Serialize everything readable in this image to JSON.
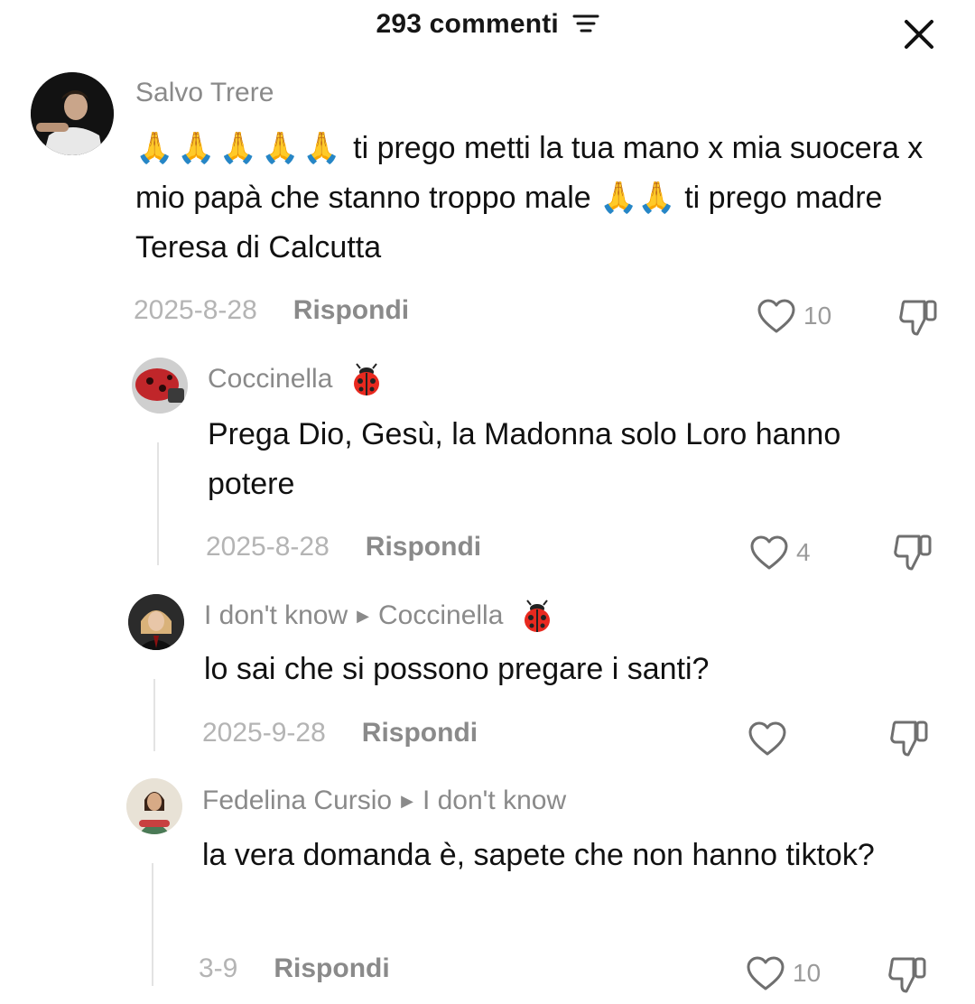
{
  "header": {
    "title": "293 commenti"
  },
  "comments": [
    {
      "username": "Salvo Trere",
      "text_prefix": "🙏🙏🙏🙏🙏",
      "text": " ti prego metti la tua mano x mia suocera x mio papà che stanno troppo male 🙏🙏 ti prego madre Teresa di Calcutta",
      "date": "2025-8-28",
      "reply_label": "Rispondi",
      "likes": "10"
    },
    {
      "username": "Coccinella",
      "text": "Prega Dio, Gesù, la Madonna solo Loro hanno potere",
      "date": "2025-8-28",
      "reply_label": "Rispondi",
      "likes": "4"
    },
    {
      "username": "I don't know",
      "reply_to": "Coccinella",
      "text": "lo sai che si possono pregare i santi?",
      "date": "2025-9-28",
      "reply_label": "Rispondi",
      "likes": ""
    },
    {
      "username": "Fedelina Cursio",
      "reply_to": "I don't know",
      "text": "la vera domanda è, sapete che non hanno tiktok?",
      "date": "3-9",
      "reply_label": "Rispondi",
      "likes": "10"
    }
  ],
  "colors": {
    "username": "#8a8a8a",
    "date": "#b4b4b4",
    "text": "#111111"
  }
}
